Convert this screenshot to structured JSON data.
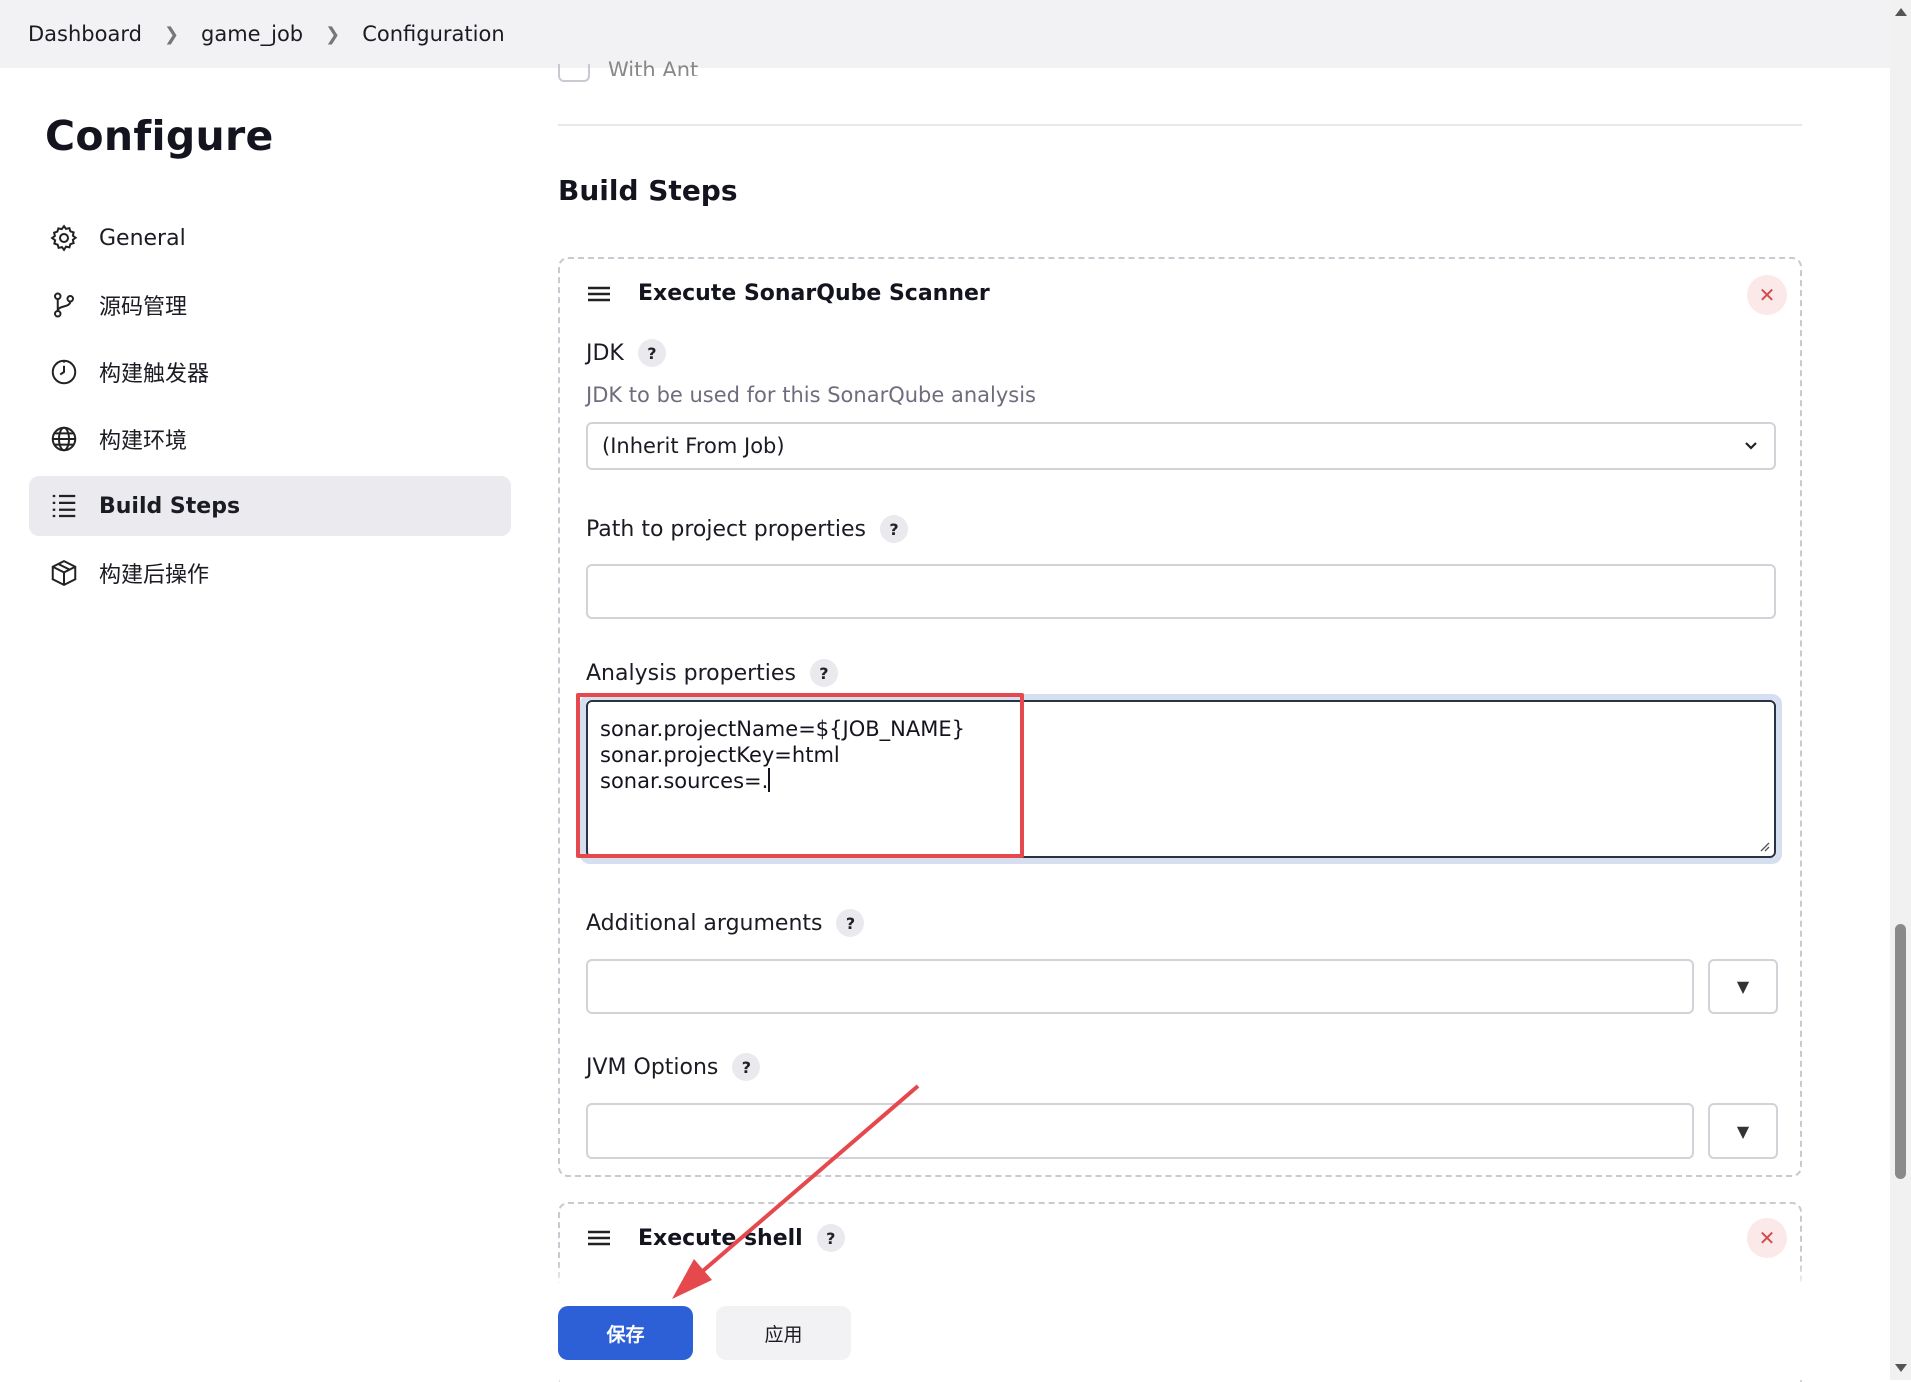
{
  "breadcrumb": {
    "items": [
      "Dashboard",
      "game_job",
      "Configuration"
    ]
  },
  "sidebar": {
    "title": "Configure",
    "items": [
      {
        "label": "General",
        "icon": "gear-icon",
        "active": false
      },
      {
        "label": "源码管理",
        "icon": "git-branch-icon",
        "active": false
      },
      {
        "label": "构建触发器",
        "icon": "timer-icon",
        "active": false
      },
      {
        "label": "构建环境",
        "icon": "globe-icon",
        "active": false
      },
      {
        "label": "Build Steps",
        "icon": "list-icon",
        "active": true
      },
      {
        "label": "构建后操作",
        "icon": "package-icon",
        "active": false
      }
    ]
  },
  "main": {
    "ghost_label": "With Ant",
    "section_title": "Build Steps",
    "sonar_step": {
      "title": "Execute SonarQube Scanner",
      "jdk": {
        "label": "JDK",
        "description": "JDK to be used for this SonarQube analysis",
        "selected": "(Inherit From Job)"
      },
      "path_label": "Path to project properties",
      "path_value": "",
      "analysis_label": "Analysis properties",
      "analysis_lines": [
        "sonar.projectName=${JOB_NAME}",
        "sonar.projectKey=html",
        "sonar.sources=."
      ],
      "additional_label": "Additional arguments",
      "additional_value": "",
      "jvm_label": "JVM Options",
      "jvm_value": ""
    },
    "shell_step": {
      "title": "Execute shell"
    }
  },
  "footer": {
    "save_label": "保存",
    "apply_label": "应用"
  },
  "colors": {
    "accent": "#2d5fd6",
    "annotation": "#e5484d",
    "active_nav_bg": "#eaeaef",
    "close_bg": "#fbe9ea"
  }
}
